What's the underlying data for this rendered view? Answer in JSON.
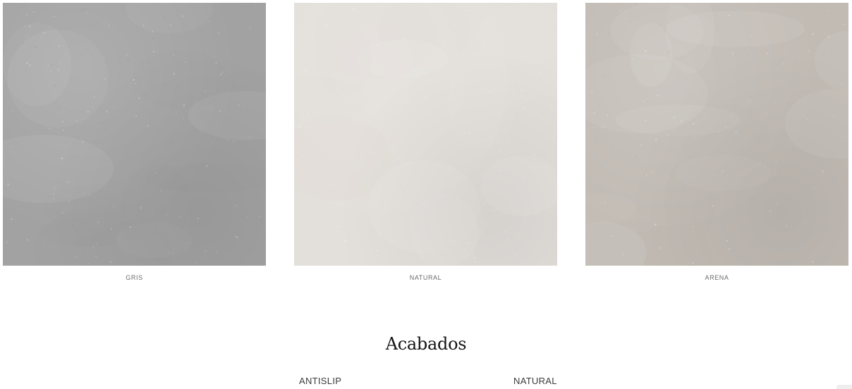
{
  "swatches": [
    {
      "label": "GRIS",
      "color": "#a3a2a2",
      "shade": "#8f8e8e"
    },
    {
      "label": "NATURAL",
      "color": "#e3dfda",
      "shade": "#d4cfc9"
    },
    {
      "label": "ARENA",
      "color": "#c1bbb4",
      "shade": "#aea8a0"
    }
  ],
  "finishes": {
    "title": "Acabados",
    "items": [
      "ANTISLIP",
      "NATURAL"
    ]
  }
}
